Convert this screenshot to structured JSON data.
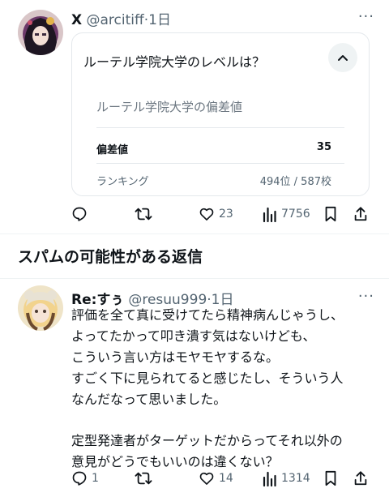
{
  "post1": {
    "name": "X",
    "handle": "@arcitiff",
    "sep": "·",
    "time": "1日",
    "more": "···",
    "card": {
      "question": "ルーテル学院大学のレベルは？",
      "subtitle": "ルーテル学院大学の偏差値",
      "rows": [
        {
          "label": "偏差値",
          "value": "35"
        },
        {
          "label": "ランキング",
          "value": "494位 / 587校"
        }
      ]
    },
    "stats": {
      "replies": "",
      "reposts": "",
      "likes": "23",
      "views": "7756"
    }
  },
  "section": {
    "title": "スパムの可能性がある返信"
  },
  "post2": {
    "name": "Re:すぅ",
    "handle": "@resuu999",
    "sep": "·",
    "time": "1日",
    "more": "···",
    "lines": [
      "評価を全て真に受けてたら精神病んじゃうし、",
      "よってたかって叩き潰す気はないけども、",
      "こういう言い方はモヤモヤするな。",
      "すごく下に見られてると感じたし、そういう人",
      "なんだなって思いました。",
      "",
      "定型発達者がターゲットだからってそれ以外の",
      "意見がどうでもいいのは違くない？"
    ],
    "stats": {
      "replies": "1",
      "reposts": "",
      "likes": "14",
      "views": "1314"
    }
  },
  "icons": [
    "reply-icon",
    "repost-icon",
    "like-icon",
    "views-icon",
    "bookmark-icon",
    "share-icon",
    "chevron-up-icon"
  ],
  "colors": {
    "text": "#0f1419",
    "secondary": "#536471",
    "border": "#e4e8ec",
    "divider": "#eff3f4"
  }
}
